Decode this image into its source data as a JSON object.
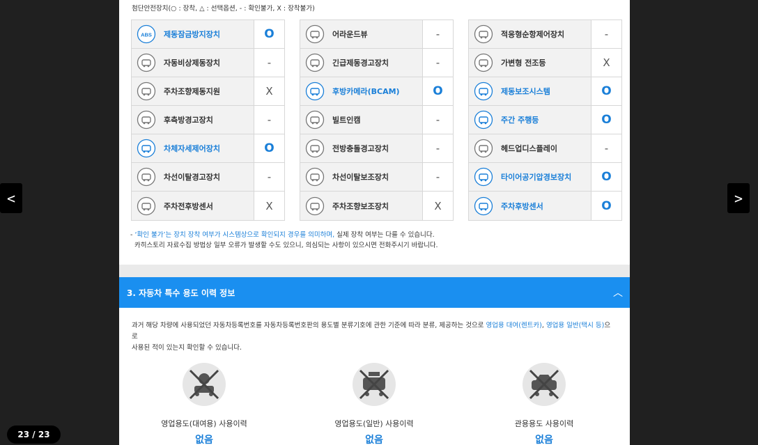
{
  "legend": "첨단안전장치(○ : 장착, △ : 선택옵션, - : 확인불가, X : 장착불가)",
  "colors": {
    "accent": "#1a7fd8",
    "section_bar": "#1a8ff0"
  },
  "features": [
    [
      {
        "icon": "abs-icon",
        "label": "제동잠금방지장치",
        "mark": "O",
        "highlight": true
      },
      {
        "icon": "emergency-brake-icon",
        "label": "자동비상제동장치",
        "mark": "-",
        "highlight": false
      },
      {
        "icon": "parking-steer-icon",
        "label": "주차조향제동지원",
        "mark": "X",
        "highlight": false
      },
      {
        "icon": "rear-side-warning-icon",
        "label": "후측방경고장치",
        "mark": "-",
        "highlight": false
      },
      {
        "icon": "stability-control-icon",
        "label": "차체자세제어장치",
        "mark": "O",
        "highlight": true
      },
      {
        "icon": "lane-departure-icon",
        "label": "차선이탈경고장치",
        "mark": "-",
        "highlight": false
      },
      {
        "icon": "parking-sensor-icon",
        "label": "주차전후방센서",
        "mark": "X",
        "highlight": false
      }
    ],
    [
      {
        "icon": "around-view-icon",
        "label": "어라운드뷰",
        "mark": "-",
        "highlight": false
      },
      {
        "icon": "emergency-brake-warning-icon",
        "label": "긴급제동경고장치",
        "mark": "-",
        "highlight": false
      },
      {
        "icon": "rear-camera-icon",
        "label": "후방카메라(BCAM)",
        "mark": "O",
        "highlight": true
      },
      {
        "icon": "built-in-cam-icon",
        "label": "빌트인캠",
        "mark": "-",
        "highlight": false
      },
      {
        "icon": "forward-collision-icon",
        "label": "전방충돌경고장치",
        "mark": "-",
        "highlight": false
      },
      {
        "icon": "lane-keep-icon",
        "label": "차선이탈보조장치",
        "mark": "-",
        "highlight": false
      },
      {
        "icon": "parking-assist-icon",
        "label": "주차조향보조장치",
        "mark": "X",
        "highlight": false
      }
    ],
    [
      {
        "icon": "adaptive-cruise-icon",
        "label": "적응형순항제어장치",
        "mark": "-",
        "highlight": false
      },
      {
        "icon": "adaptive-headlight-icon",
        "label": "가변형 전조등",
        "mark": "X",
        "highlight": false
      },
      {
        "icon": "brake-assist-icon",
        "label": "제동보조시스템",
        "mark": "O",
        "highlight": true
      },
      {
        "icon": "daytime-light-icon",
        "label": "주간 주행등",
        "mark": "O",
        "highlight": true
      },
      {
        "icon": "head-up-display-icon",
        "label": "헤드업디스플레이",
        "mark": "-",
        "highlight": false
      },
      {
        "icon": "tire-pressure-icon",
        "label": "타이어공기압경보장치",
        "mark": "O",
        "highlight": true
      },
      {
        "icon": "rear-parking-sensor-icon",
        "label": "주차후방센서",
        "mark": "O",
        "highlight": true
      }
    ]
  ],
  "note": {
    "prefix": "- ",
    "hl_quote": "‘확인 불가’는 장치 장착 여부가 시스템상으로 확인되지 경우를 의미하며,",
    "rest": " 실제 장착 여부는 다를 수 있습니다.",
    "line2": "카히스토리 자료수집 방법상 일부 오류가 발생할 수도 있으니, 의심되는 사항이 있으시면 전화주시기 바랍니다."
  },
  "section": {
    "title": "3. 자동차 특수 용도 이력 정보",
    "chevron": "︿"
  },
  "description": {
    "part1": "과거 해당 차량에 사용되었던 자동차등록번호를 자동차등록번호판의 용도별 분류기호에 관한 기준에 따라 분류, 제공하는 것으로 ",
    "hl1": "영업용 대여(렌트카)",
    "sep": ", ",
    "hl2": "영업용 일반(택시 등)",
    "part2": "으로",
    "line2": "사용된 적이 있는지 확인할 수 있습니다."
  },
  "usage": [
    {
      "icon": "rental-car-icon",
      "label": "영업용도(대여용) 사용이력",
      "value": "없음"
    },
    {
      "icon": "taxi-icon",
      "label": "영업용도(일반) 사용이력",
      "value": "없음"
    },
    {
      "icon": "government-car-icon",
      "label": "관용용도 사용이력",
      "value": "없음"
    }
  ],
  "nav": {
    "prev": "<",
    "next": ">",
    "counter": "23 / 23"
  }
}
